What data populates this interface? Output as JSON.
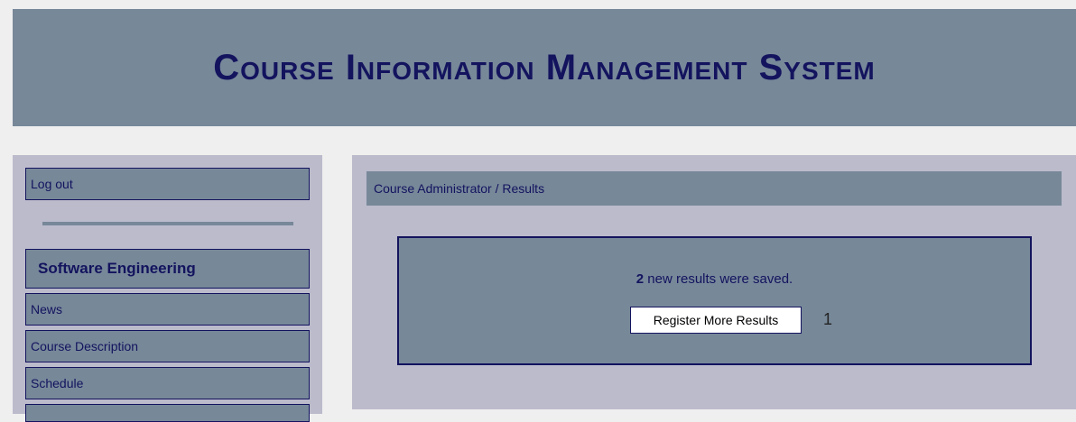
{
  "header": {
    "title": "Course Information Management System"
  },
  "sidebar": {
    "logout_label": "Log out",
    "course_title": "Software Engineering",
    "items": [
      {
        "label": "News"
      },
      {
        "label": "Course Description"
      },
      {
        "label": "Schedule"
      }
    ]
  },
  "main": {
    "breadcrumb": "Course Administrator / Results",
    "message": {
      "count": "2",
      "text": "new results were saved."
    },
    "register_button_label": "Register More Results",
    "page_number": "1"
  },
  "colors": {
    "header_bg": "#778899",
    "panel_bg": "#bbbbcc",
    "text_dark_blue": "#13135e",
    "page_bg": "#efefef"
  }
}
